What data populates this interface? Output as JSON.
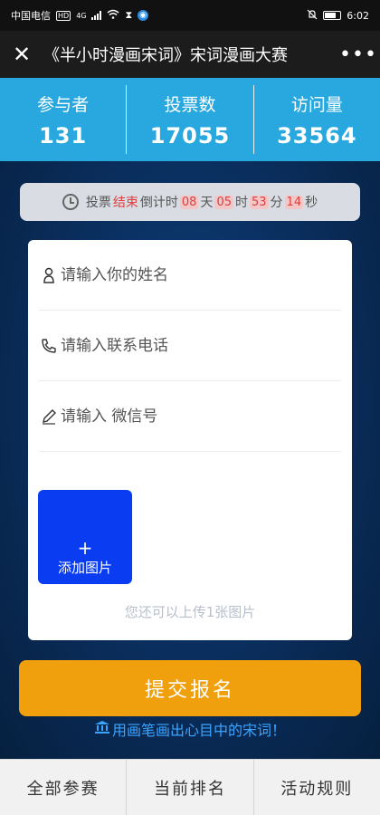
{
  "statusbar": {
    "carrier": "中国电信",
    "network": "4G",
    "hd_badge": "HD",
    "time": "6:02"
  },
  "titlebar": {
    "close_icon": "close-icon",
    "title": "《半小时漫画宋词》宋词漫画大赛",
    "more_icon": "more-icon"
  },
  "stats": [
    {
      "label": "参与者",
      "value": "131"
    },
    {
      "label": "投票数",
      "value": "17055"
    },
    {
      "label": "访问量",
      "value": "33564"
    }
  ],
  "countdown": {
    "prefix": "投票",
    "status": "结束",
    "middle": "倒计时",
    "days": "08",
    "days_unit": "天",
    "hours": "05",
    "hours_unit": "时",
    "minutes": "53",
    "minutes_unit": "分",
    "seconds": "14",
    "seconds_unit": "秒"
  },
  "form": {
    "name_placeholder": "请输入你的姓名",
    "phone_placeholder": "请输入联系电话",
    "wechat_placeholder": "请输入 微信号",
    "upload_plus": "+",
    "upload_label": "添加图片",
    "upload_hint": "您还可以上传1张图片"
  },
  "submit_label": "提交报名",
  "slogan": "用画笔画出心目中的宋词！",
  "tabs": [
    "全部参赛",
    "当前排名",
    "活动规则"
  ],
  "colors": {
    "stats_bg": "#29a8df",
    "submit_bg": "#f1a00d",
    "upload_bg": "#0a3df2",
    "slogan": "#3aa5ff"
  }
}
